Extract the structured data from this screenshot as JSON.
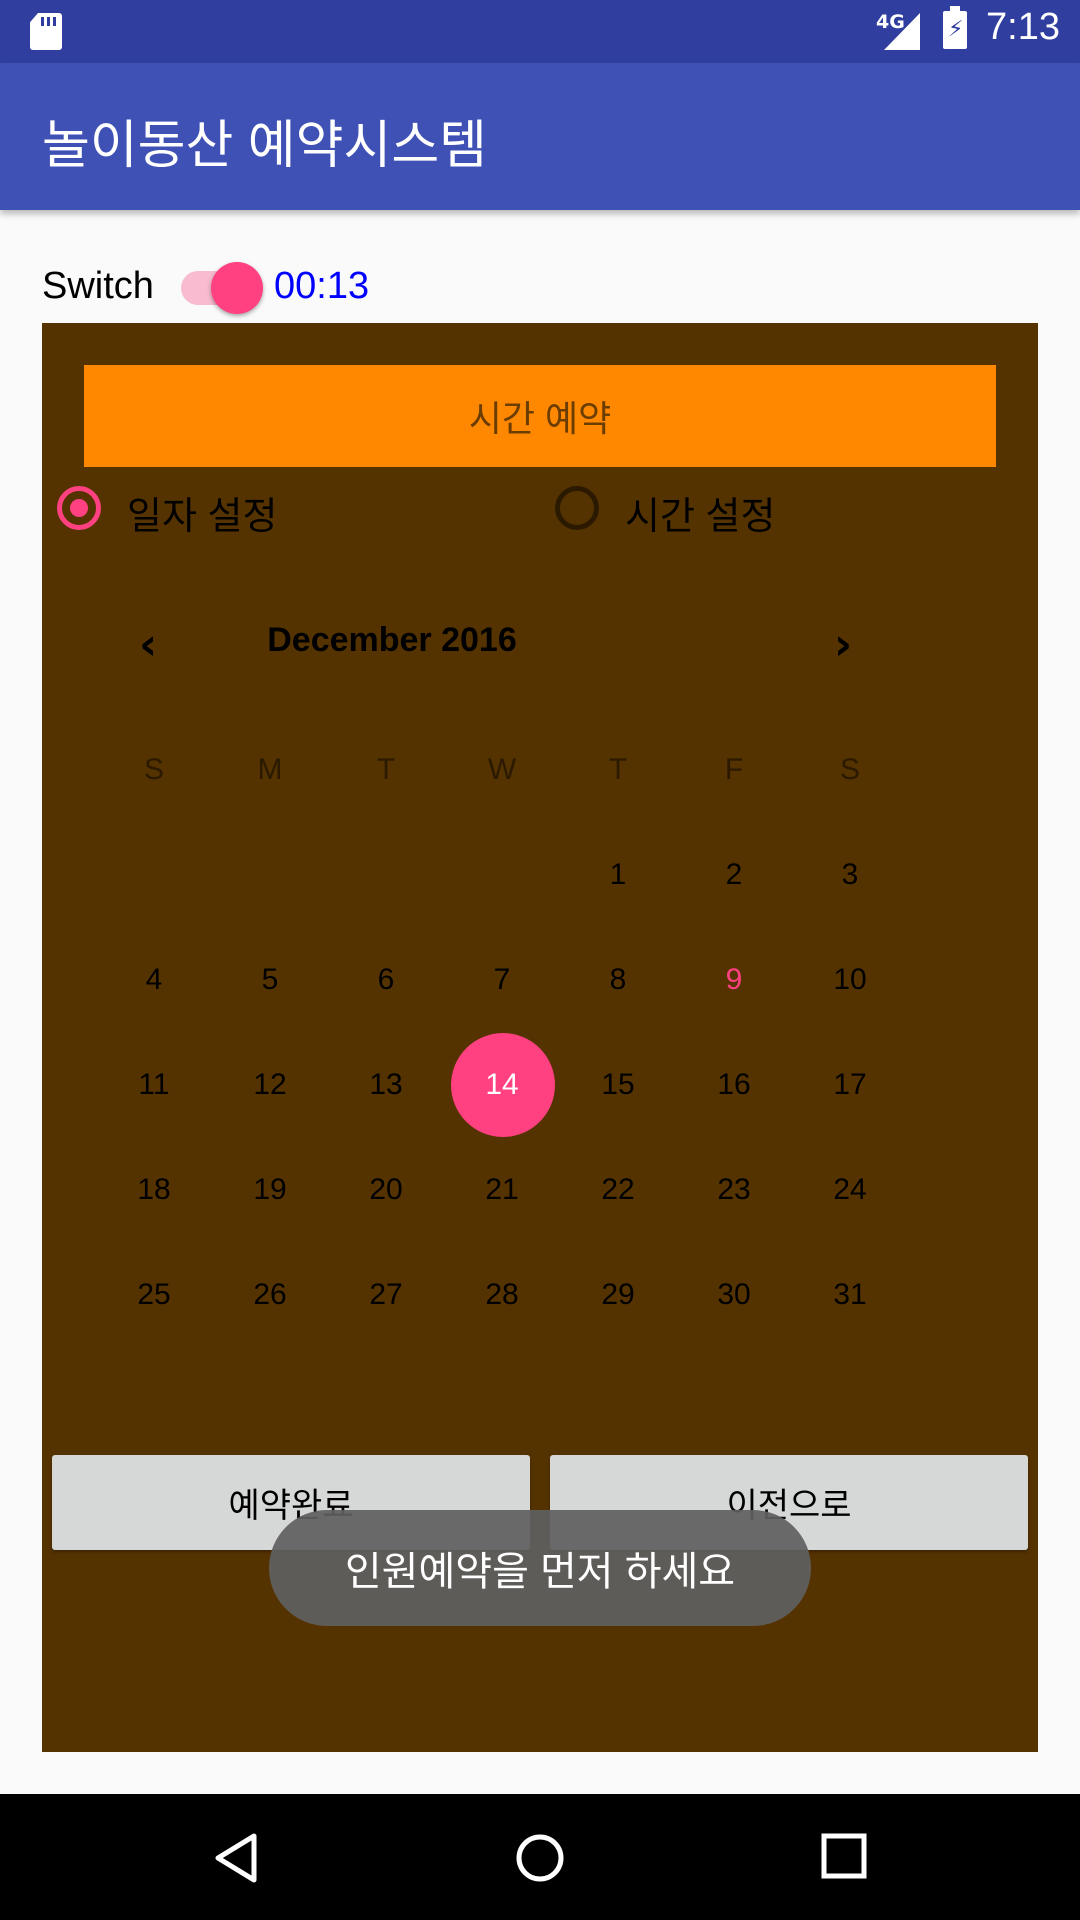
{
  "status_bar": {
    "network": "4G",
    "time": "7:13",
    "icons": [
      "sd-card-icon",
      "signal-icon",
      "battery-charging-icon"
    ]
  },
  "app_bar": {
    "title": "놀이동산 예약시스템"
  },
  "switch_row": {
    "label": "Switch",
    "checked": true,
    "timer": "00:13"
  },
  "panel": {
    "background": "#553300",
    "reserve_button": "시간 예약",
    "radios": [
      {
        "label": "일자 설정",
        "checked": true
      },
      {
        "label": "시간 설정",
        "checked": false
      }
    ],
    "calendar": {
      "month": "December 2016",
      "weekdays": [
        "S",
        "M",
        "T",
        "W",
        "T",
        "F",
        "S"
      ],
      "weeks": [
        [
          "",
          "",
          "",
          "",
          "1",
          "2",
          "3"
        ],
        [
          "4",
          "5",
          "6",
          "7",
          "8",
          "9",
          "10"
        ],
        [
          "11",
          "12",
          "13",
          "14",
          "15",
          "16",
          "17"
        ],
        [
          "18",
          "19",
          "20",
          "21",
          "22",
          "23",
          "24"
        ],
        [
          "25",
          "26",
          "27",
          "28",
          "29",
          "30",
          "31"
        ]
      ],
      "today": "9",
      "selected": "14"
    },
    "buttons": {
      "complete": "예약완료",
      "back": "이전으로"
    }
  },
  "toast": "인원예약을 먼저 하세요",
  "colors": {
    "accent": "#ff4081",
    "primary": "#3f51b5",
    "primary_dark": "#303f9f",
    "reserve": "#ff8800"
  }
}
